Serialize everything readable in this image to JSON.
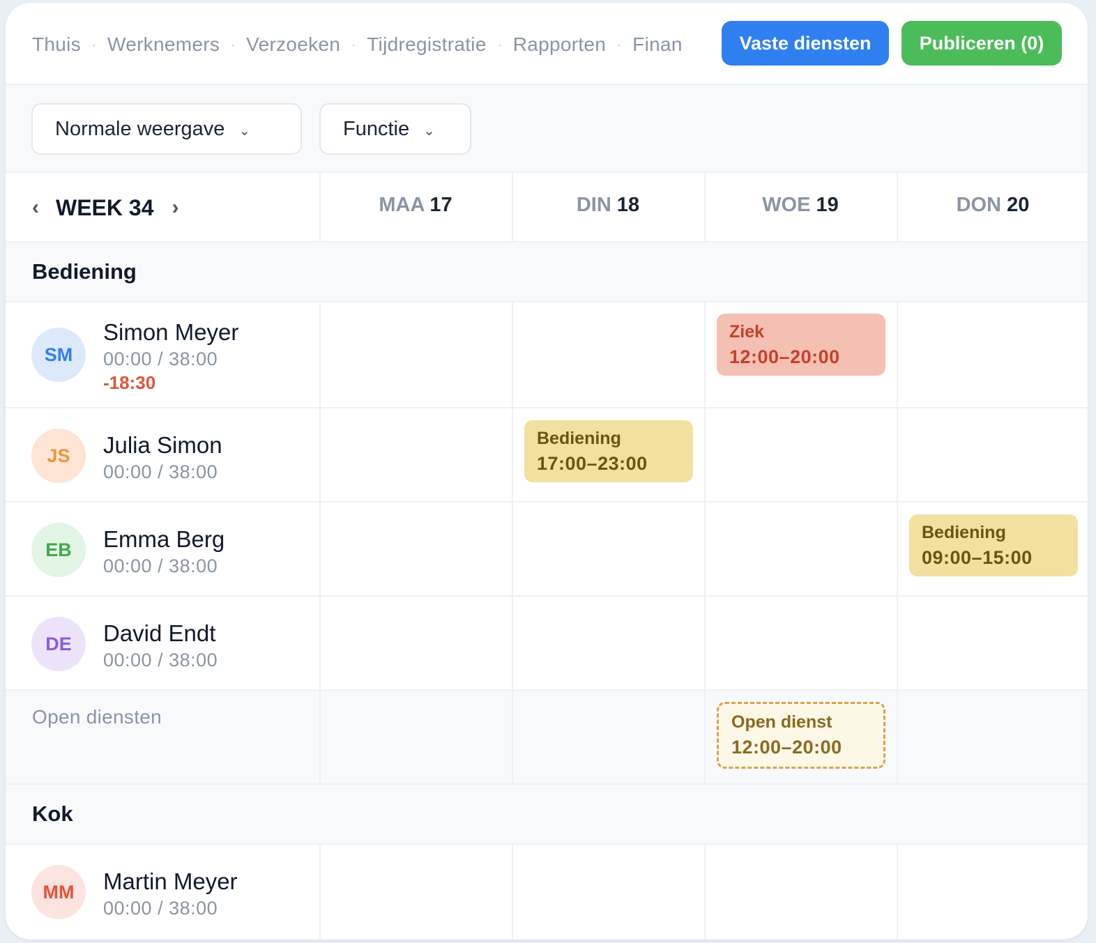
{
  "nav": {
    "items": [
      "Thuis",
      "Werknemers",
      "Verzoeken",
      "Tijdregistratie",
      "Rapporten",
      "Finan"
    ],
    "separator": "·"
  },
  "buttons": {
    "fixed_shifts": "Vaste diensten",
    "publish": "Publiceren (0)"
  },
  "filters": {
    "view": "Normale weergave",
    "function": "Functie",
    "chevron": "⌄"
  },
  "week": {
    "label": "WEEK 34",
    "prev": "‹",
    "next": "›"
  },
  "days": [
    {
      "name": "MAA",
      "date": "17"
    },
    {
      "name": "DIN",
      "date": "18"
    },
    {
      "name": "WOE",
      "date": "19"
    },
    {
      "name": "DON",
      "date": "20"
    }
  ],
  "sections": {
    "bediening": "Bediening",
    "kok": "Kok"
  },
  "employees": [
    {
      "initials": "SM",
      "name": "Simon Meyer",
      "hours": "00:00 / 38:00",
      "diff": "-18:30"
    },
    {
      "initials": "JS",
      "name": "Julia Simon",
      "hours": "00:00 / 38:00"
    },
    {
      "initials": "EB",
      "name": "Emma Berg",
      "hours": "00:00 / 38:00"
    },
    {
      "initials": "DE",
      "name": "David Endt",
      "hours": "00:00 / 38:00"
    },
    {
      "initials": "MM",
      "name": "Martin Meyer",
      "hours": "00:00 / 38:00"
    }
  ],
  "shifts": {
    "simon_woe": {
      "label": "Ziek",
      "time": "12:00–20:00"
    },
    "julia_din": {
      "label": "Bediening",
      "time": "17:00–23:00"
    },
    "emma_don": {
      "label": "Bediening",
      "time": "09:00–15:00"
    },
    "open_woe": {
      "label": "Open dienst",
      "time": "12:00–20:00"
    }
  },
  "open_shifts_label": "Open diensten",
  "colors": {
    "primary_blue": "#2f7ff0",
    "publish_green": "#4cbb5a",
    "sick_bg": "#f4c0b4",
    "shift_bg": "#f2e0a0",
    "negative_text": "#e0533a"
  }
}
